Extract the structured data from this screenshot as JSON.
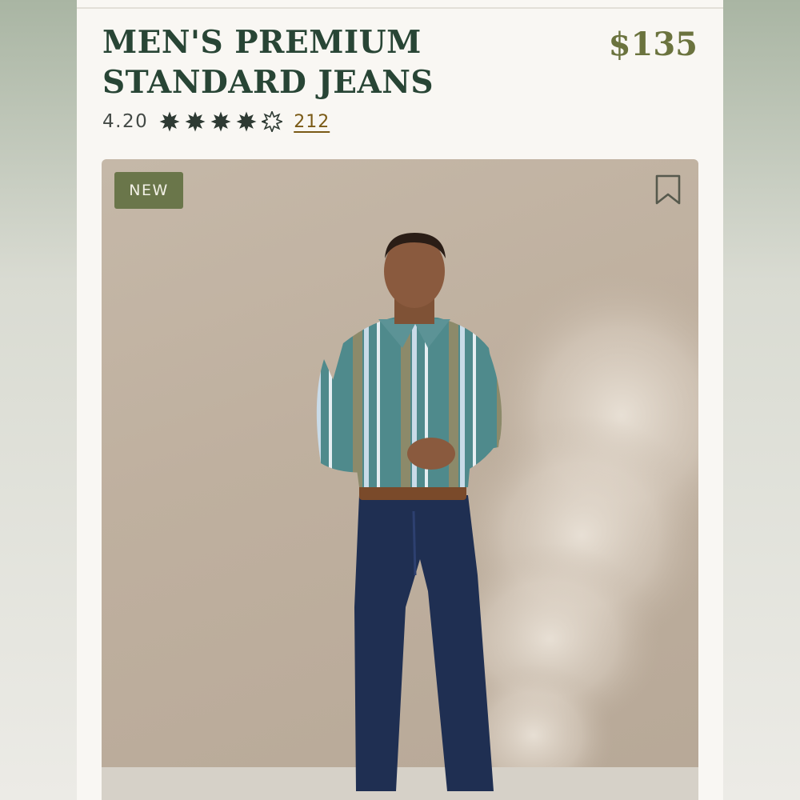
{
  "product": {
    "title": "MEN'S PREMIUM STANDARD JEANS",
    "price": "$135",
    "rating_value": "4.20",
    "rating_fraction": 0.84,
    "stars_total": 5,
    "review_count": "212"
  },
  "image": {
    "badge": "NEW",
    "bookmark_icon": "bookmark-icon",
    "description_colors": {
      "backdrop": "#c2b4a3",
      "shirt_teal": "#4f8a8c",
      "shirt_olive": "#8c8a6a",
      "shirt_stripe": "#c9dbe8",
      "jeans": "#1f2f52",
      "belt": "#7a4a2a",
      "skin": "#8a5a3e"
    }
  },
  "colors": {
    "title": "#284535",
    "price": "#6b733e",
    "star": "#2e3a33",
    "link": "#7a5a16",
    "badge_bg": "#6a764a",
    "page_bg": "#f9f7f3"
  }
}
